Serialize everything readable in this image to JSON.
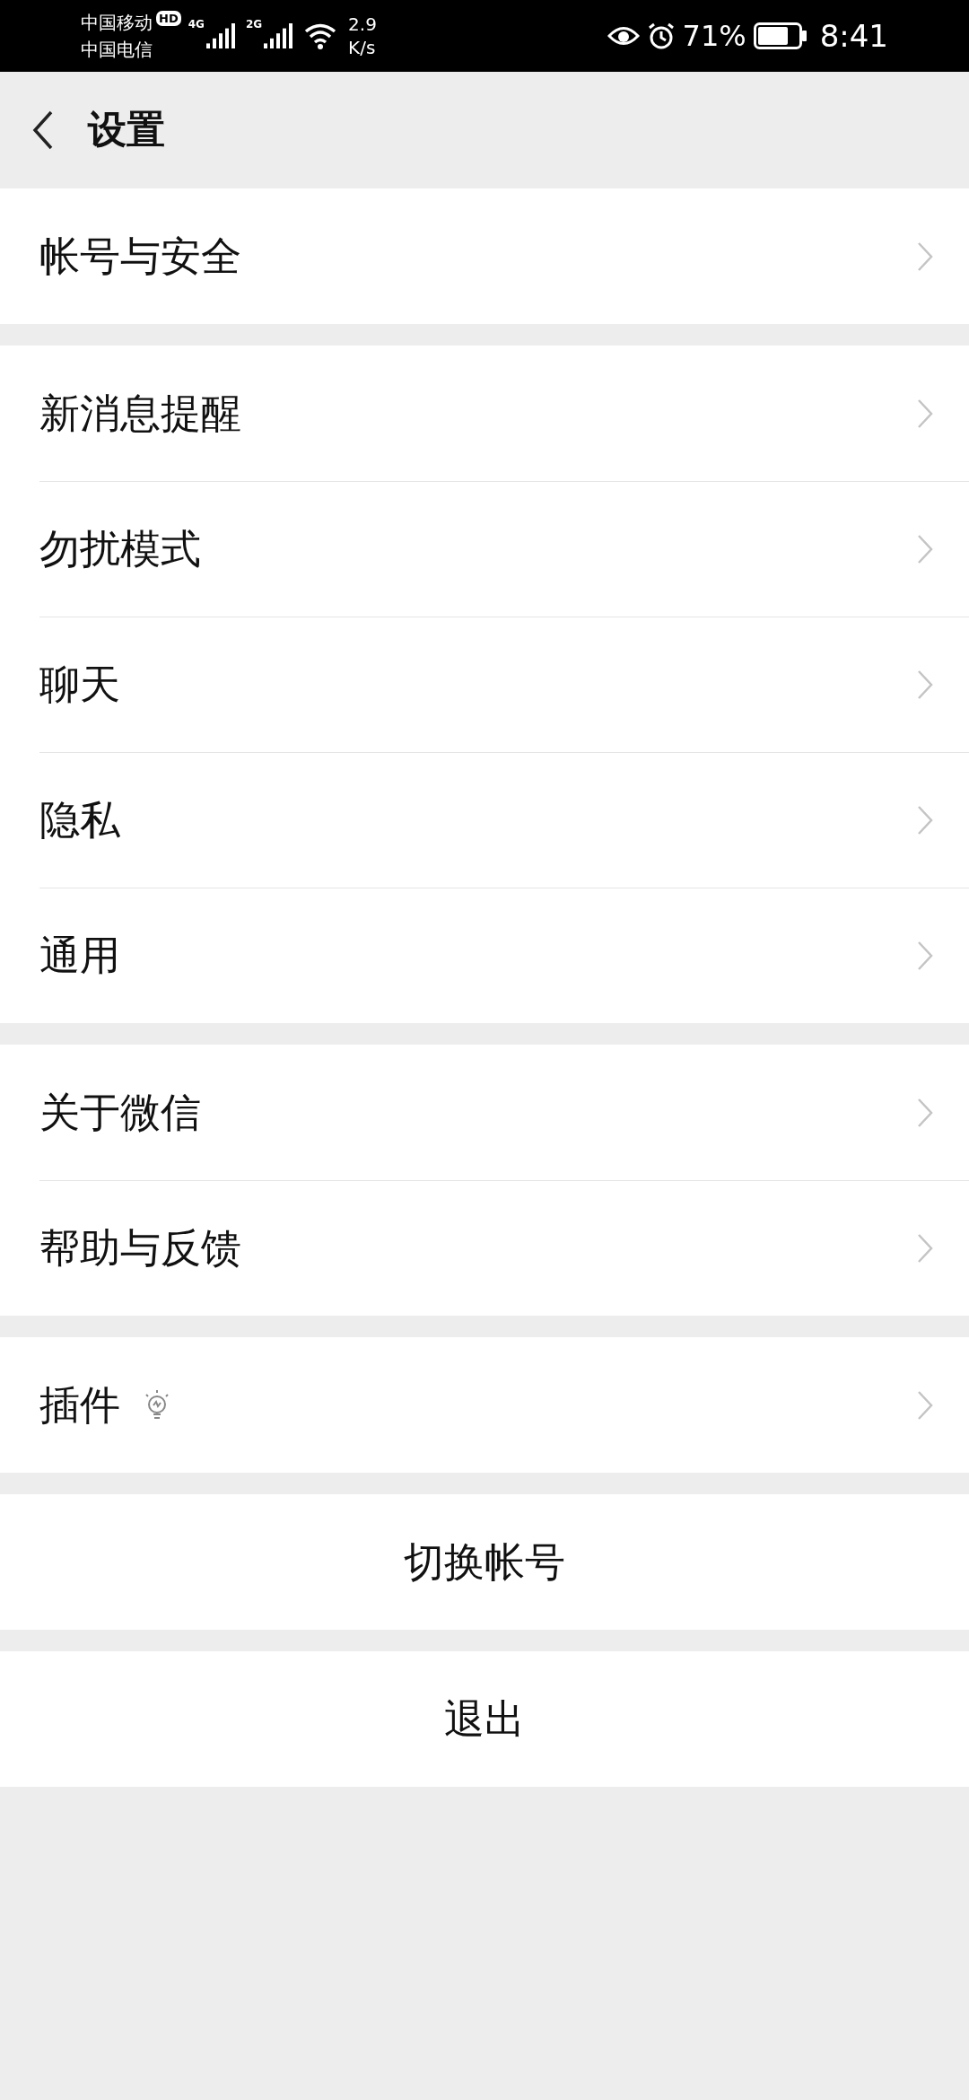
{
  "status_bar": {
    "carrier_1": "中国移动",
    "carrier_2": "中国电信",
    "hd_badge": "HD",
    "network_1": "4G",
    "network_2": "2G",
    "speed_value": "2.9",
    "speed_unit": "K/s",
    "battery_percent": "71%",
    "time": "8:41"
  },
  "header": {
    "title": "设置"
  },
  "groups": [
    [
      {
        "label": "帐号与安全",
        "kind": "nav"
      }
    ],
    [
      {
        "label": "新消息提醒",
        "kind": "nav"
      },
      {
        "label": "勿扰模式",
        "kind": "nav"
      },
      {
        "label": "聊天",
        "kind": "nav"
      },
      {
        "label": "隐私",
        "kind": "nav"
      },
      {
        "label": "通用",
        "kind": "nav"
      }
    ],
    [
      {
        "label": "关于微信",
        "kind": "nav"
      },
      {
        "label": "帮助与反馈",
        "kind": "nav"
      }
    ],
    [
      {
        "label": "插件",
        "kind": "nav_with_icon"
      }
    ]
  ],
  "buttons": [
    "切换帐号",
    "退出"
  ]
}
